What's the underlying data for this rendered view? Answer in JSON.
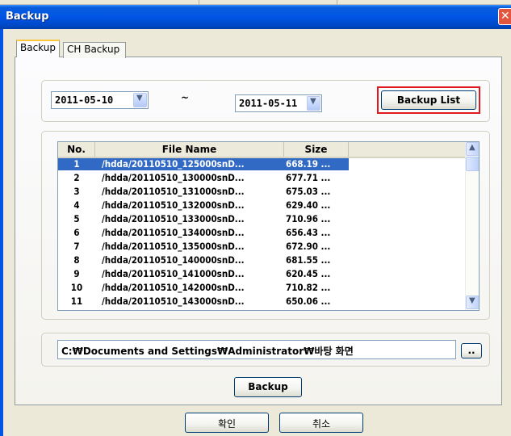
{
  "window": {
    "title": "Backup"
  },
  "tabs": [
    {
      "label": "Backup"
    },
    {
      "label": "CH Backup"
    }
  ],
  "date_range": {
    "start": "2011-05-10",
    "separator": "~",
    "end": "2011-05-11"
  },
  "buttons": {
    "backup_list": "Backup List",
    "browse": "..",
    "backup": "Backup",
    "ok": "확인",
    "cancel": "취소"
  },
  "file_list": {
    "columns": [
      "No.",
      "File Name",
      "Size"
    ],
    "rows": [
      {
        "no": "1",
        "file": "/hdda/20110510_125000snD...",
        "size": "668.19 ..."
      },
      {
        "no": "2",
        "file": "/hdda/20110510_130000snD...",
        "size": "677.71 ..."
      },
      {
        "no": "3",
        "file": "/hdda/20110510_131000snD...",
        "size": "675.03 ..."
      },
      {
        "no": "4",
        "file": "/hdda/20110510_132000snD...",
        "size": "629.40 ..."
      },
      {
        "no": "5",
        "file": "/hdda/20110510_133000snD...",
        "size": "710.96 ..."
      },
      {
        "no": "6",
        "file": "/hdda/20110510_134000snD...",
        "size": "656.43 ..."
      },
      {
        "no": "7",
        "file": "/hdda/20110510_135000snD...",
        "size": "672.90 ..."
      },
      {
        "no": "8",
        "file": "/hdda/20110510_140000snD...",
        "size": "681.55 ..."
      },
      {
        "no": "9",
        "file": "/hdda/20110510_141000snD...",
        "size": "620.45 ..."
      },
      {
        "no": "10",
        "file": "/hdda/20110510_142000snD...",
        "size": "710.82 ..."
      },
      {
        "no": "11",
        "file": "/hdda/20110510_143000snD...",
        "size": "650.06 ..."
      }
    ]
  },
  "save_path": "C:₩Documents and Settings₩Administrator₩바탕 화면",
  "icons": {
    "close": "close-icon",
    "dropdown": "chevron-down-icon",
    "scroll_up": "scroll-up-arrow-icon",
    "scroll_down": "scroll-down-arrow-icon"
  },
  "colors": {
    "titlebar": "#0055e5",
    "selection": "#316ac5",
    "highlight_outline": "#e0191e"
  }
}
